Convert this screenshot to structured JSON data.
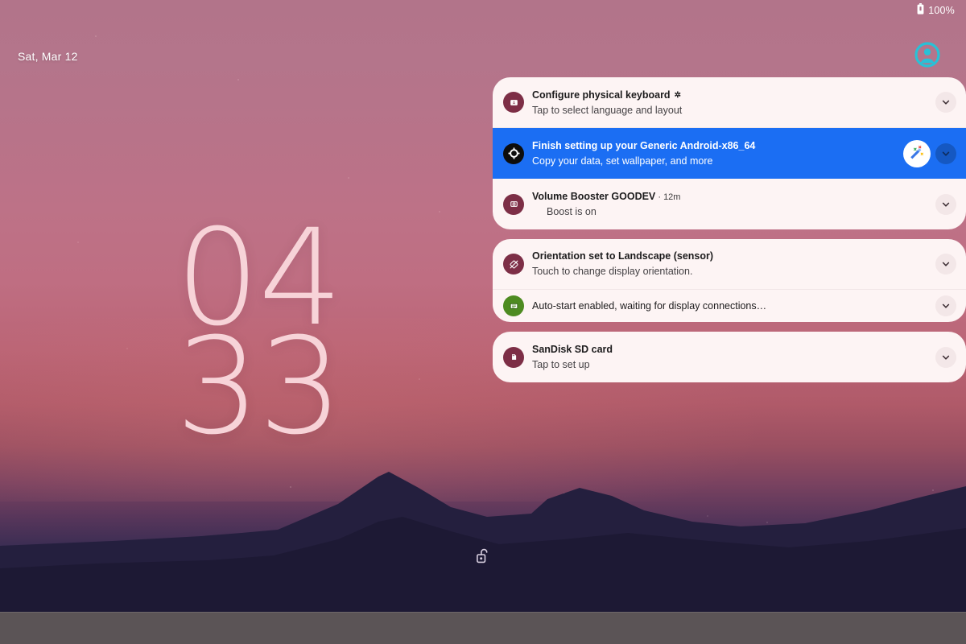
{
  "status_bar": {
    "battery_icon": "battery-full-icon",
    "battery_text": "100%"
  },
  "lock_screen": {
    "date": "Sat, Mar 12",
    "clock_hours": "04",
    "clock_minutes": "33",
    "avatar_icon": "user-avatar-icon",
    "lock_icon": "unlocked-padlock-icon",
    "clock_color": "#f7d3d8",
    "avatar_color": "#29c1d6"
  },
  "notifications": [
    {
      "id": "configure-physical-keyboard",
      "icon": "keyboard-android-icon",
      "icon_color": "#7d2e46",
      "title": "Configure physical keyboard",
      "title_glyph": "✲",
      "text": "Tap to select language and layout",
      "chevron_icon": "chevron-down-icon",
      "highlighted": false
    },
    {
      "id": "finish-setup",
      "icon": "android-setup-icon",
      "icon_color": "#0d0d0d",
      "title": "Finish setting up your Generic Android-x86_64",
      "text": "Copy your data, set wallpaper, and more",
      "action_icon": "magic-wand-icon",
      "chevron_icon": "chevron-down-icon",
      "highlighted": true,
      "highlight_color": "#1b6ef3"
    },
    {
      "id": "volume-booster",
      "icon": "volume-booster-icon",
      "icon_color": "#7d2e46",
      "title": "Volume Booster GOODEV",
      "time": "12m",
      "separator": "·",
      "text": "Boost is on",
      "chevron_icon": "chevron-down-icon",
      "highlighted": false
    },
    {
      "id": "orientation",
      "icon": "rotation-locked-icon",
      "icon_color": "#7d2e46",
      "title": "Orientation set to Landscape (sensor)",
      "text": "Touch to change display orientation.",
      "chevron_icon": "chevron-down-icon",
      "highlighted": false
    },
    {
      "id": "auto-start",
      "icon": "display-connection-icon",
      "icon_color": "#4e8b21",
      "title": "Auto-start enabled, waiting for display connections…",
      "chevron_icon": "chevron-down-icon",
      "highlighted": false
    },
    {
      "id": "sandisk-sd-card",
      "icon": "sd-card-icon",
      "icon_color": "#7d2e46",
      "title": "SanDisk SD card",
      "text": "Tap to set up",
      "chevron_icon": "chevron-down-icon",
      "highlighted": false
    }
  ]
}
